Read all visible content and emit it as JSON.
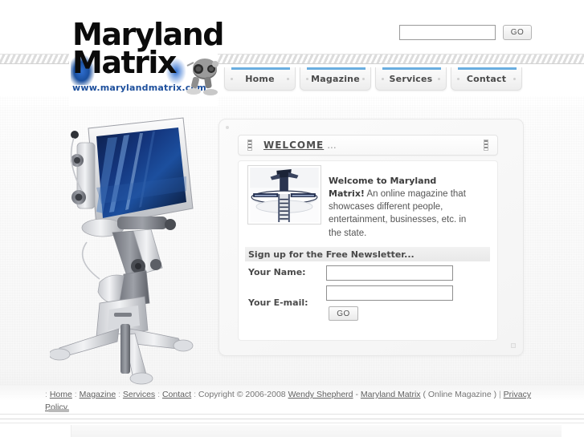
{
  "site": {
    "logo_line1": "Maryland",
    "logo_line2": "Matrix",
    "logo_url": "www.marylandmatrix.com"
  },
  "search": {
    "value": "",
    "placeholder": "",
    "go_label": "GO"
  },
  "nav": {
    "items": [
      {
        "label": "Home"
      },
      {
        "label": "Magazine"
      },
      {
        "label": "Services"
      },
      {
        "label": "Contact"
      }
    ]
  },
  "panel": {
    "title": "WELCOME",
    "title_suffix": "...",
    "intro_bold": "Welcome to Maryland Matrix!",
    "intro_rest": " An online magazine that showcases different people, entertainment, businesses, etc. in the state."
  },
  "newsletter": {
    "heading": "Sign up for the Free Newsletter...",
    "name_label": "Your Name:",
    "name_value": "",
    "email_label": "Your E-mail:",
    "email_value": "",
    "go_label": "GO"
  },
  "footer": {
    "lead_sep": ":",
    "links": [
      {
        "label": "Home"
      },
      {
        "label": "Magazine"
      },
      {
        "label": "Services"
      },
      {
        "label": "Contact"
      }
    ],
    "copyright": "Copyright © 2006-2008",
    "author": "Wendy Shepherd",
    "dash": "-",
    "site_name": "Maryland Matrix",
    "descriptor": "( Online Magazine )",
    "pipe": "|",
    "privacy": "Privacy Policy"
  },
  "colors": {
    "accent_blue": "#6aaee0",
    "logo_blue": "#1d4f9c",
    "text_dark": "#4a4a4a",
    "text_body": "#555555"
  },
  "icons": {
    "robot_mascot": "robot-mascot-icon",
    "robot_hero": "robot-display-illustration",
    "thumbnail": "futuristic-structure-thumbnail",
    "grip": "grip-handle-icon"
  }
}
